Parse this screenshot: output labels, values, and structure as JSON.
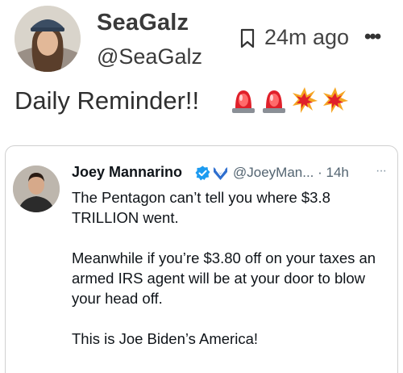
{
  "post": {
    "display_name": "SeaGalz",
    "handle": "@SeaGalz",
    "timestamp": "24m ago",
    "text": "Daily Reminder!!",
    "emojis": [
      "police-light",
      "police-light",
      "collision",
      "collision"
    ]
  },
  "quoted": {
    "display_name": "Joey Mannarino",
    "handle_time": "@JoeyMan... · 14h",
    "paragraphs": [
      "The Pentagon can’t tell you where $3.8 TRILLION went.",
      "Meanwhile if you’re $3.80 off on your taxes an armed IRS agent will be at your door to blow your head off.",
      "This is Joe Biden’s America!"
    ]
  },
  "colors": {
    "verified": "#1d9bf0",
    "badge": "#2f6fcf",
    "siren_red": "#e0202a"
  }
}
